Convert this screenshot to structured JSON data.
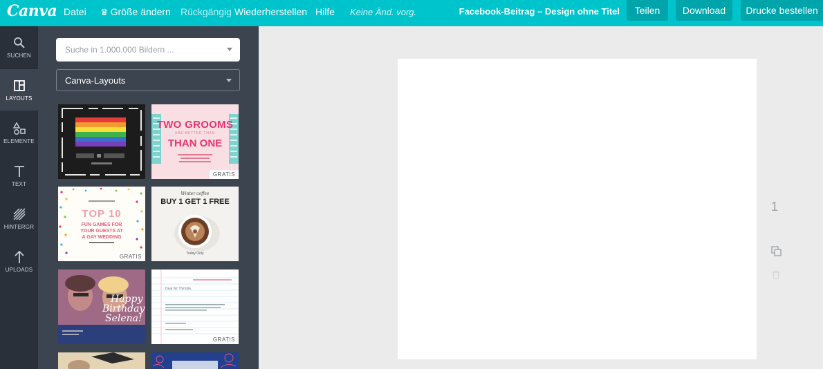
{
  "topbar": {
    "logo": "Canva",
    "menu": {
      "file": "Datei",
      "resize": "Größe ändern",
      "undo": "Rückgängig",
      "redo": "Wiederherstellen",
      "help": "Hilfe",
      "status": "Keine Änd. vorg."
    },
    "doc_title": "Facebook-Beitrag – Design ohne Titel",
    "share_label": "Teilen",
    "download_label": "Download",
    "print_label": "Drucke bestellen",
    "accent_color": "#00c4cc"
  },
  "rail": {
    "items": [
      {
        "label": "SUCHEN",
        "icon": "search-icon"
      },
      {
        "label": "LAYOUTS",
        "icon": "layouts-icon"
      },
      {
        "label": "ELEMENTE",
        "icon": "elements-icon"
      },
      {
        "label": "TEXT",
        "icon": "text-icon"
      },
      {
        "label": "HINTERGR",
        "icon": "background-icon"
      },
      {
        "label": "UPLOADS",
        "icon": "upload-icon"
      }
    ]
  },
  "panel": {
    "search_placeholder": "Suche in 1.000.000 Bildern ...",
    "layout_select": "Canva-Layouts",
    "badge": "GRATIS",
    "templates": {
      "t2": {
        "line1": "TWO GROOMS",
        "line2": "THAN ONE",
        "small": "ARE BETTER THAN"
      },
      "t3": {
        "line1": "TOP 10",
        "line2": "FUN GAMES FOR",
        "line3": "YOUR GUESTS AT",
        "line4": "A GAY WEDDING"
      },
      "t4": {
        "line1": "Winter coffee",
        "line2": "BUY 1 GET 1 FREE",
        "small": "Today Only"
      },
      "t5": {
        "line1": "Happy",
        "line2": "Birthday",
        "line3": "Selena!"
      },
      "t6": {
        "line1": "Dear Mr Thimble,"
      }
    }
  },
  "canvas": {
    "page_number": "1"
  }
}
